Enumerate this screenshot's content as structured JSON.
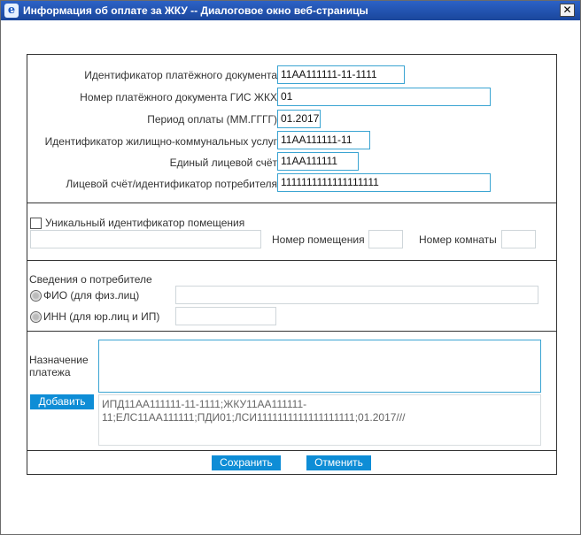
{
  "window": {
    "title": "Информация об оплате за ЖКУ -- Диалоговое окно веб-страницы",
    "icon": "ie-icon",
    "close_symbol": "✕"
  },
  "form": {
    "fields": [
      {
        "label": "Идентификатор платёжного документа",
        "value": "11АА111111-11-1111"
      },
      {
        "label": "Номер платёжного документа ГИС ЖКХ",
        "value": "01"
      },
      {
        "label": "Период оплаты (ММ.ГГГГ)",
        "value": "01.2017"
      },
      {
        "label": "Идентификатор жилищно-коммунальных услуг",
        "value": "11АА111111-11"
      },
      {
        "label": "Единый лицевой счёт",
        "value": "11АА111111"
      },
      {
        "label": "Лицевой счёт/идентификатор потребителя",
        "value": "1111111111111111111"
      }
    ],
    "premises": {
      "checkbox_label": "Уникальный идентификатор помещения",
      "checked": false,
      "unique_id_value": "",
      "room_number_label": "Номер помещения",
      "room_number_value": "",
      "room_label": "Номер комнаты",
      "room_value": ""
    },
    "consumer": {
      "section_title": "Сведения о потребителе",
      "fio_label": "ФИО (для физ.лиц)",
      "fio_value": "",
      "inn_label": "ИНН (для юр.лиц и ИП)",
      "inn_value": ""
    },
    "payment": {
      "purpose_label_line1": "Назначение",
      "purpose_label_line2": "платежа",
      "purpose_value": "",
      "add_button": "Добавить",
      "result_text": "ИПД11АА111111-11-1111;ЖКУ11АА111111-11;ЕЛС11АА111111;ПДИ01;ЛСИ1111111111111111111;01.2017///"
    }
  },
  "footer": {
    "save_label": "Сохранить",
    "cancel_label": "Отменить"
  },
  "colors": {
    "titlebar": "#1f4fa8",
    "accent_border": "#3aa4d2",
    "button": "#0e8dd6"
  }
}
